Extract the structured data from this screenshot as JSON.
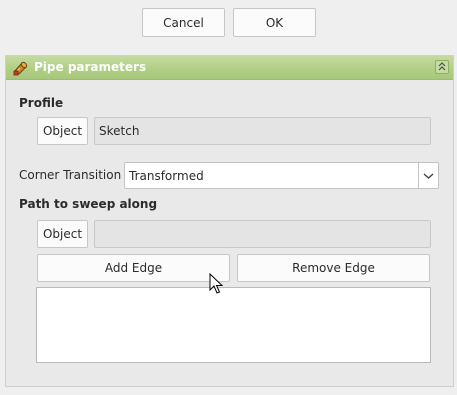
{
  "dialog_buttons": {
    "cancel": "Cancel",
    "ok": "OK"
  },
  "panel": {
    "title": "Pipe parameters",
    "title_icon": "pipe-icon",
    "collapse_icon": "collapse-chevrons-icon"
  },
  "profile": {
    "section_label": "Profile",
    "object_button": "Object",
    "value": "Sketch"
  },
  "corner_transition": {
    "label": "Corner Transition",
    "selected": "Transformed",
    "dropdown_icon": "chevron-down-icon"
  },
  "path": {
    "section_label": "Path to sweep along",
    "object_button": "Object",
    "value": "",
    "add_edge_button": "Add Edge",
    "remove_edge_button": "Remove Edge",
    "edges": []
  },
  "colors": {
    "header_green": "#b1cf86",
    "background": "#efefef"
  }
}
